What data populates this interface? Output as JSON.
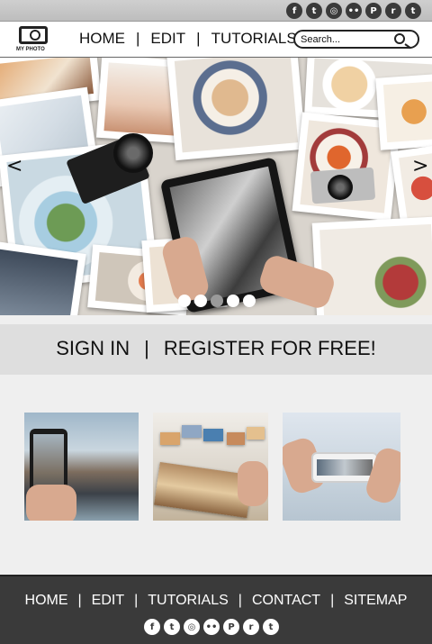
{
  "topbar": {
    "social_icons": [
      {
        "name": "facebook-icon",
        "glyph": "f"
      },
      {
        "name": "twitter-icon",
        "glyph": "t"
      },
      {
        "name": "instagram-icon",
        "glyph": "◎"
      },
      {
        "name": "flickr-icon",
        "glyph": "••"
      },
      {
        "name": "pinterest-icon",
        "glyph": "P"
      },
      {
        "name": "reddit-icon",
        "glyph": "r"
      },
      {
        "name": "twitter-alt-icon",
        "glyph": "t"
      }
    ]
  },
  "nav": {
    "logo_text": "MY PHOTO",
    "items": [
      "HOME",
      "EDIT",
      "TUTORIALS"
    ],
    "separator": "|",
    "search_placeholder": "Search..."
  },
  "hero": {
    "prev_arrow": "<",
    "next_arrow": ">",
    "slide_count": 5,
    "active_slide": 3
  },
  "auth": {
    "sign_in": "SIGN IN",
    "separator": "|",
    "register": "REGISTER FOR FREE!"
  },
  "footer": {
    "links": [
      "HOME",
      "EDIT",
      "TUTORIALS",
      "CONTACT",
      "SITEMAP"
    ],
    "separator": "|"
  },
  "colors": {
    "footer_bg": "#3a3a3a",
    "band_bg": "#dedede",
    "page_bg": "#efefef"
  }
}
